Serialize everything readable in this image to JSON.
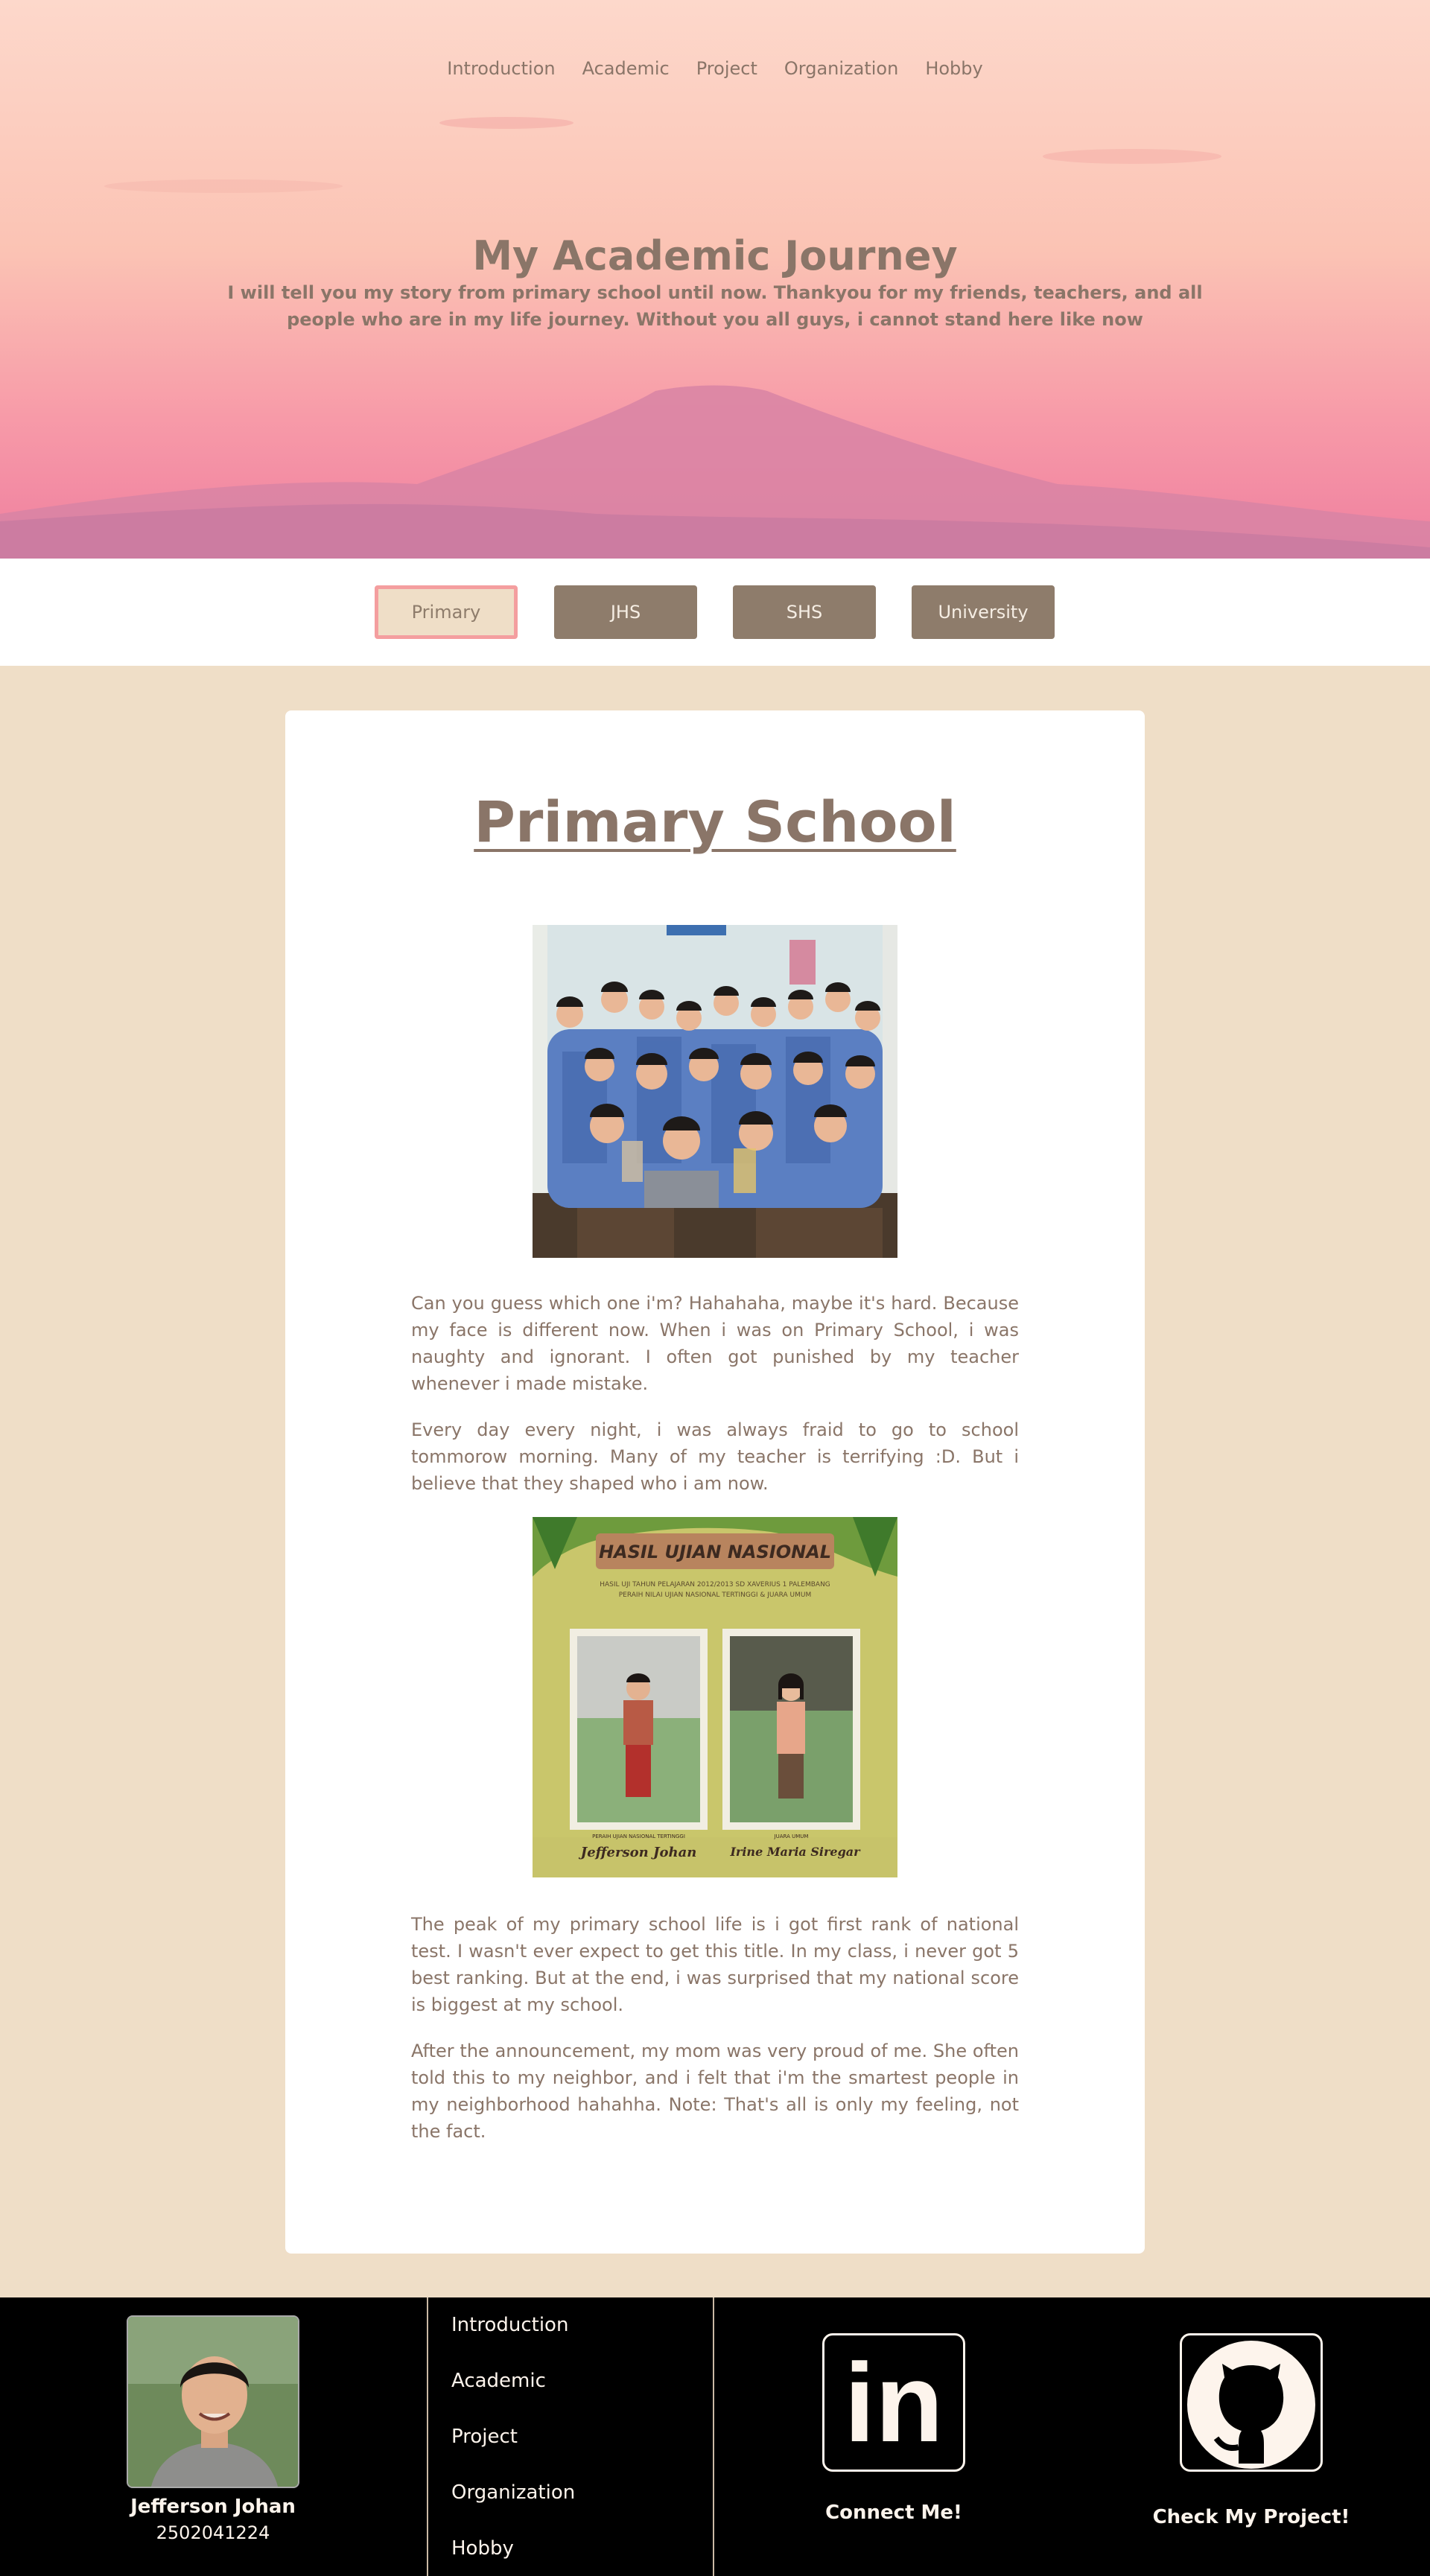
{
  "nav": {
    "items": [
      {
        "label": "Introduction"
      },
      {
        "label": "Academic"
      },
      {
        "label": "Project"
      },
      {
        "label": "Organization"
      },
      {
        "label": "Hobby"
      }
    ]
  },
  "hero": {
    "title": "My Academic Journey",
    "subtitle": "I will tell you my story from primary school until now. Thankyou for my friends, teachers, and all people who are in my life journey. Without you all guys, i cannot stand here like now"
  },
  "tabs": {
    "items": [
      {
        "label": "Primary",
        "active": true
      },
      {
        "label": "JHS",
        "active": false
      },
      {
        "label": "SHS",
        "active": false
      },
      {
        "label": "University",
        "active": false
      }
    ]
  },
  "content": {
    "title": "Primary School",
    "paragraphs": [
      "Can you guess which one i'm? Hahahaha, maybe it's hard. Because my face is different now. When i was on Primary School, i was naughty and ignorant. I often got punished by my teacher whenever i made mistake.",
      "Every day every night, i was always fraid to go to school tommorow morning. Many of my teacher is terrifying :D. But i believe that they shaped who i am now.",
      "The peak of my primary school life is i got first rank of national test. I wasn't ever expect to get this title. In my class, i never got 5 best ranking. But at the end, i was surprised that my national score is biggest at my school.",
      "After the announcement, my mom was very proud of me. She often told this to my neighbor, and i felt that i'm the smartest people in my neighborhood hahahha. Note: That's all is only my feeling, not the fact."
    ],
    "poster": {
      "heading": "HASIL UJIAN NASIONAL",
      "line1": "HASIL UJI TAHUN PELAJARAN 2012/2013 SD XAVERIUS 1 PALEMBANG",
      "line2": "PERAIH NILAI UJIAN NASIONAL TERTINGGI & JUARA UMUM",
      "caption_left": "PERAIH UJIAN NASIONAL TERTINGGI",
      "caption_right": "JUARA UMUM",
      "name_left": "Jefferson Johan",
      "name_right": "Irine Maria Siregar"
    }
  },
  "footer": {
    "name": "Jefferson Johan",
    "id": "2502041224",
    "links": [
      {
        "label": "Introduction"
      },
      {
        "label": "Academic"
      },
      {
        "label": "Project"
      },
      {
        "label": "Organization"
      },
      {
        "label": "Hobby"
      }
    ],
    "linkedin_icon_text": "in",
    "linkedin_label": "Connect Me!",
    "github_label": "Check My Project!"
  },
  "colors": {
    "accent": "#8e7c6b",
    "beige": "#efdec7",
    "active_border": "#f49e9f",
    "footer_bg": "#000000"
  }
}
